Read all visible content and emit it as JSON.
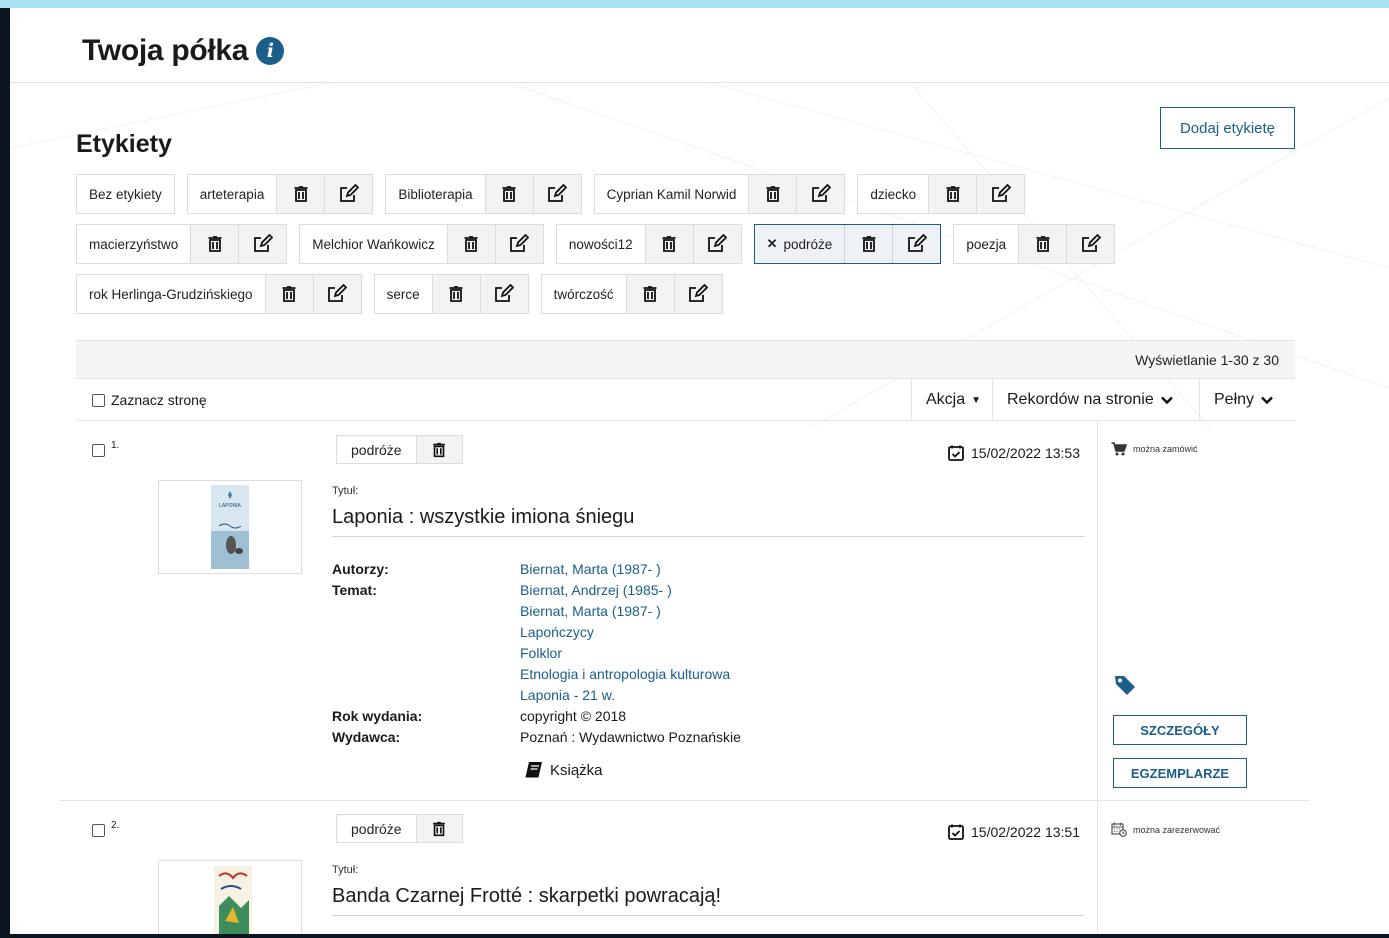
{
  "page": {
    "title": "Twoja półka",
    "info_icon": "info-icon"
  },
  "labels": {
    "title": "Etykiety",
    "add_button": "Dodaj etykietę",
    "rows": [
      [
        {
          "name": "Bez etykiety",
          "actions": false,
          "active": false
        },
        {
          "name": "arteterapia",
          "actions": true,
          "active": false
        },
        {
          "name": "Biblioterapia",
          "actions": true,
          "active": false
        },
        {
          "name": "Cyprian Kamil Norwid",
          "actions": true,
          "active": false
        },
        {
          "name": "dziecko",
          "actions": true,
          "active": false
        }
      ],
      [
        {
          "name": "macierzyństwo",
          "actions": true,
          "active": false
        },
        {
          "name": "Melchior Wańkowicz",
          "actions": true,
          "active": false
        },
        {
          "name": "nowości12",
          "actions": true,
          "active": false
        },
        {
          "name": "podróże",
          "actions": true,
          "active": true
        },
        {
          "name": "poezja",
          "actions": true,
          "active": false
        }
      ],
      [
        {
          "name": "rok Herlinga-Grudzińskiego",
          "actions": true,
          "active": false
        },
        {
          "name": "serce",
          "actions": true,
          "active": false
        },
        {
          "name": "twórczość",
          "actions": true,
          "active": false
        }
      ]
    ],
    "icons": {
      "delete": "trash-icon",
      "edit": "edit-icon",
      "remove": "close-icon"
    }
  },
  "toolbar": {
    "count": "Wyświetlanie 1-30 z 30",
    "select_page": "Zaznacz stronę",
    "action": "Akcja",
    "per_page": "Rekordów na stronie",
    "view": "Pełny"
  },
  "records": [
    {
      "num": "1.",
      "tag": "podróże",
      "date": "15/02/2022 13:53",
      "title_label": "Tytuł:",
      "title": "Laponia : wszystkie imiona śniegu",
      "cover_text": "LAPONIA",
      "fields": {
        "authors_label": "Autorzy:",
        "subject_label": "Temat:",
        "year_label": "Rok wydania:",
        "publisher_label": "Wydawca:",
        "links": [
          "Biernat, Marta (1987- )",
          "Biernat, Andrzej (1985- )",
          "Biernat, Marta (1987- )",
          "Lapończycy",
          "Folklor",
          "Etnologia i antropologia kulturowa",
          "Laponia - 21 w."
        ],
        "year": "copyright © 2018",
        "publisher": "Poznań : Wydawnictwo Poznańskie"
      },
      "type": "Książka",
      "availability": "można zamówić",
      "details_button": "SZCZEGÓŁY",
      "copies_button": "EGZEMPLARZE"
    },
    {
      "num": "2.",
      "tag": "podróże",
      "date": "15/02/2022 13:51",
      "title_label": "Tytuł:",
      "title": "Banda Czarnej Frotté : skarpetki powracają!",
      "availability": "można zarezerwować"
    }
  ],
  "colors": {
    "accent": "#1a5e8a",
    "frame": "#a9e2f3",
    "toolbar_bg": "#f5f5f5"
  }
}
